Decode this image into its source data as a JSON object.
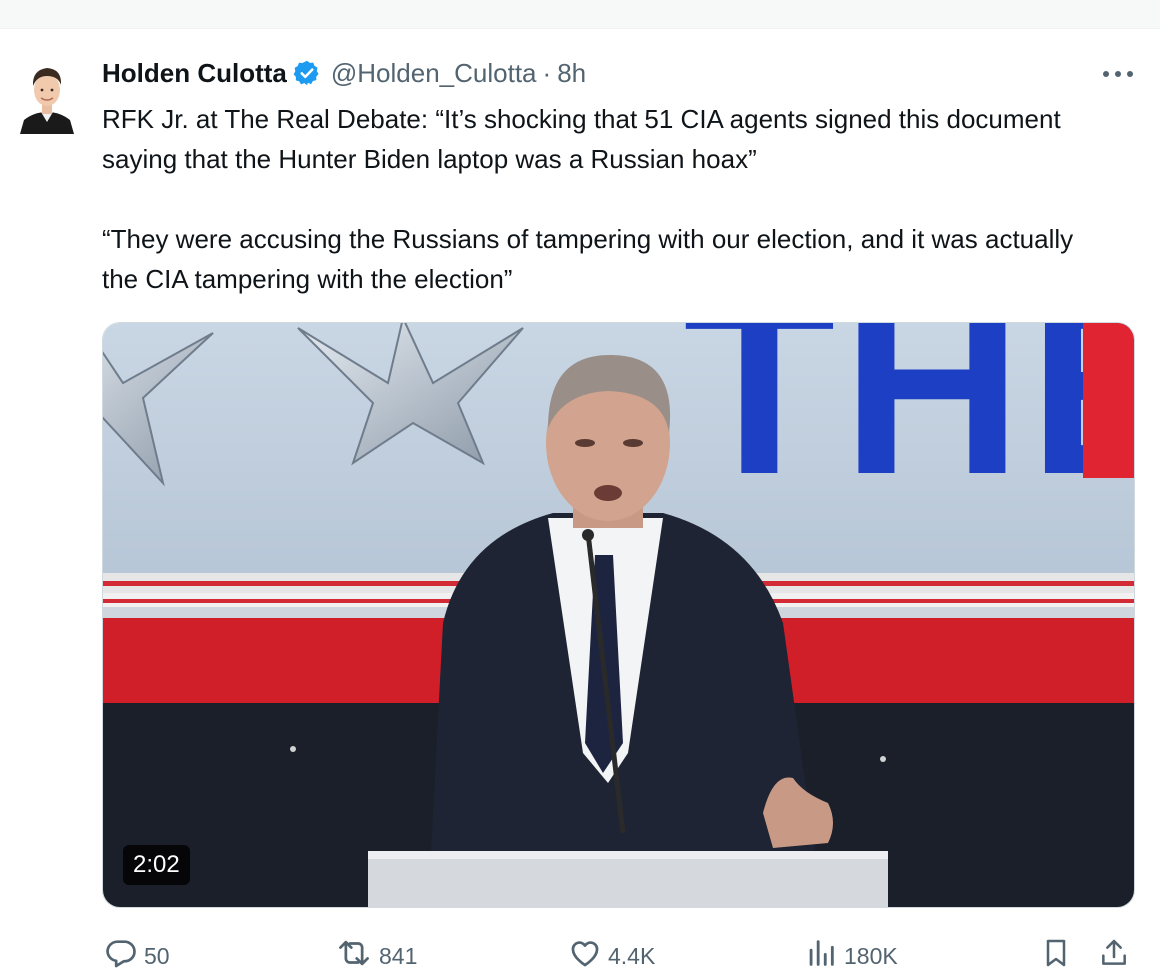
{
  "tweet": {
    "display_name": "Holden Culotta",
    "handle": "@Holden_Culotta",
    "separator": "·",
    "time": "8h",
    "paragraph_1": "RFK Jr. at The Real Debate: “It’s shocking that 51 CIA agents signed this document saying that the Hunter Biden laptop was a Russian hoax”",
    "paragraph_2": "“They were accusing the Russians of tampering with our election, and it was actually the CIA tampering with the election”"
  },
  "media": {
    "duration": "2:02",
    "backdrop_letters": "THE"
  },
  "actions": {
    "replies": "50",
    "reposts": "841",
    "likes": "4.4K",
    "views": "180K"
  },
  "icons": {
    "verified": "verified-badge-icon",
    "more": "more-dots-icon",
    "reply": "reply-icon",
    "repost": "repost-icon",
    "like": "heart-icon",
    "views": "views-icon",
    "bookmark": "bookmark-icon",
    "share": "share-icon"
  },
  "colors": {
    "verified_blue": "#1d9bf0",
    "muted_text": "#536471",
    "text": "#0f1419"
  }
}
